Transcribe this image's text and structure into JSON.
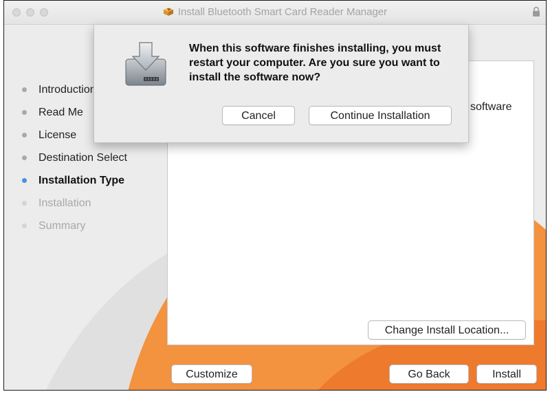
{
  "window": {
    "title": "Install Bluetooth Smart Card Reader Manager"
  },
  "sidebar": {
    "steps": [
      {
        "label": "Introduction",
        "state": "done"
      },
      {
        "label": "Read Me",
        "state": "done"
      },
      {
        "label": "License",
        "state": "done"
      },
      {
        "label": "Destination Select",
        "state": "done"
      },
      {
        "label": "Installation Type",
        "state": "active"
      },
      {
        "label": "Installation",
        "state": "future"
      },
      {
        "label": "Summary",
        "state": "future"
      }
    ]
  },
  "panel": {
    "partial_text": "software",
    "change_location_label": "Change Install Location..."
  },
  "footer": {
    "customize_label": "Customize",
    "go_back_label": "Go Back",
    "install_label": "Install"
  },
  "dialog": {
    "message": "When this software finishes installing, you must restart your computer. Are you sure you want to install the software now?",
    "cancel_label": "Cancel",
    "continue_label": "Continue Installation"
  },
  "colors": {
    "accent": "#4a90e2",
    "background_art": "#f3923f"
  },
  "icons": {
    "title": "package-icon",
    "lock": "lock-icon",
    "dialog": "installer-disk-icon"
  }
}
